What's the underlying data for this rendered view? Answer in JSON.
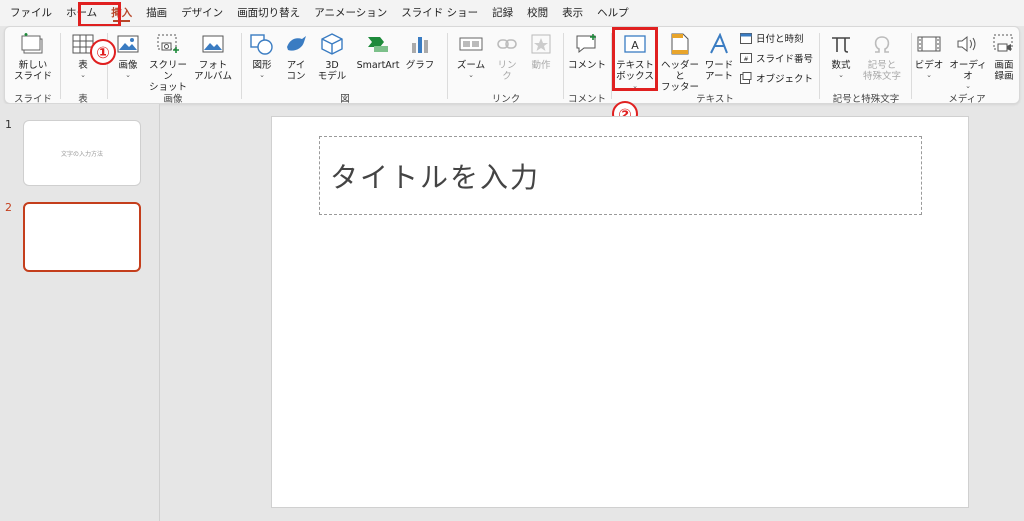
{
  "tabs": [
    "ファイル",
    "ホーム",
    "挿入",
    "描画",
    "デザイン",
    "画面切り替え",
    "アニメーション",
    "スライド ショー",
    "記録",
    "校閲",
    "表示",
    "ヘルプ"
  ],
  "active_tab": "挿入",
  "callouts": {
    "one": "①",
    "two": "②"
  },
  "ribbon": {
    "groups": {
      "slide": "スライド",
      "table": "表",
      "images": "画像",
      "figure": "図",
      "link": "リンク",
      "comment": "コメント",
      "text": "テキスト",
      "symbols": "記号と特殊文字",
      "media": "メディア"
    },
    "buttons": {
      "new_slide": "新しい\nスライド",
      "table": "表",
      "image": "画像",
      "screenshot": "スクリーン\nショット",
      "photo_album": "フォト\nアルバム",
      "shapes": "図形",
      "icons": "アイ\nコン",
      "model3d": "3D\nモデル",
      "smartart": "SmartArt",
      "graph": "グラフ",
      "zoom": "ズーム",
      "link": "リン\nク",
      "action": "動作",
      "comment": "コメント",
      "textbox": "テキスト\nボックス",
      "header_footer": "ヘッダーと\nフッター",
      "wordart": "ワード\nアート",
      "date_time": "日付と時刻",
      "slide_number": "スライド番号",
      "object": "オブジェクト",
      "equation": "数式",
      "symbol": "記号と\n特殊文字",
      "video": "ビデオ",
      "audio": "オーディオ",
      "screen_record": "画面\n録画"
    }
  },
  "thumbnails": [
    {
      "number": "1",
      "title": "文字の入力方法"
    },
    {
      "number": "2",
      "title": ""
    }
  ],
  "slide": {
    "title_placeholder": "タイトルを入力"
  },
  "colors": {
    "accent": "#b7472a",
    "highlight": "#e02020"
  }
}
